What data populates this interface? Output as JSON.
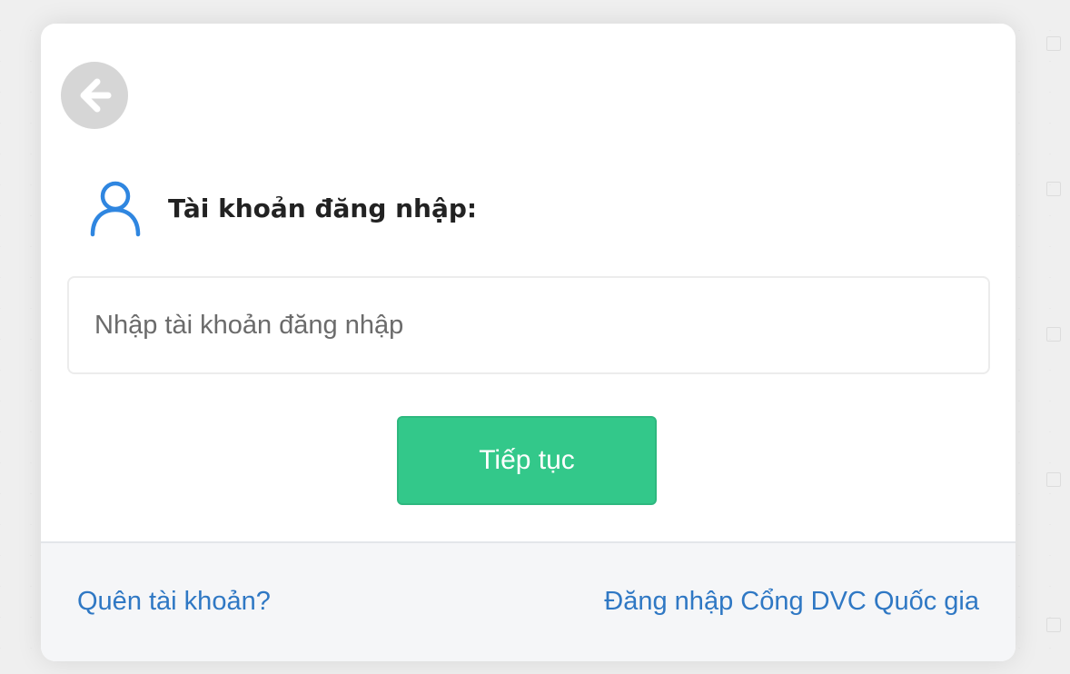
{
  "login": {
    "back_icon": "arrow-left-circle-icon",
    "user_icon": "user-outline-icon",
    "account_label": "Tài khoản đăng nhập:",
    "account_input": {
      "placeholder": "Nhập tài khoản đăng nhập",
      "value": ""
    },
    "continue_label": "Tiếp tục",
    "forgot_account_link": "Quên tài khoản?",
    "national_portal_link": "Đăng nhập Cổng DVC Quốc gia"
  },
  "colors": {
    "primary_button": "#33c88a",
    "link": "#2f78c4",
    "user_icon": "#2f86e0",
    "back_button_bg": "#d6d6d6"
  }
}
